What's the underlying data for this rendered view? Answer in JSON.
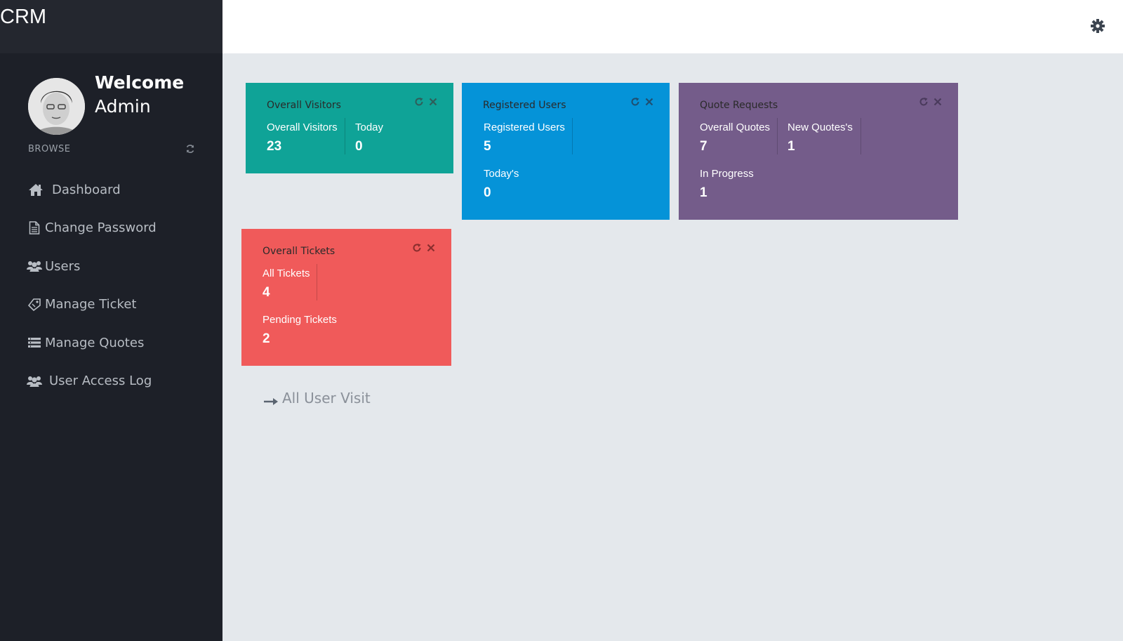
{
  "app": {
    "brand": "CRM"
  },
  "profile": {
    "welcome": "Welcome",
    "name": "Admin"
  },
  "sidebar": {
    "section_label": "BROWSE",
    "items": [
      {
        "label": "Dashboard",
        "icon": "home-icon"
      },
      {
        "label": "Change Password",
        "icon": "file-icon"
      },
      {
        "label": "Users",
        "icon": "users-icon"
      },
      {
        "label": "Manage Ticket",
        "icon": "ticket-icon"
      },
      {
        "label": "Manage Quotes",
        "icon": "list-icon"
      },
      {
        "label": "User Access Log",
        "icon": "users-icon"
      }
    ]
  },
  "widgets": {
    "visitors": {
      "title": "Overall Visitors",
      "color": "#0fa397",
      "stats": [
        {
          "label": "Overall Visitors",
          "value": "23"
        },
        {
          "label": "Today",
          "value": "0"
        }
      ]
    },
    "users": {
      "title": "Registered Users",
      "color": "#0593d8",
      "stats": [
        {
          "label": "Registered Users",
          "value": "5"
        },
        {
          "label": "Today's",
          "value": "0"
        }
      ]
    },
    "quotes": {
      "title": "Quote Requests",
      "color": "#745c8a",
      "stats": [
        {
          "label": "Overall Quotes",
          "value": "7"
        },
        {
          "label": "New Quotes's",
          "value": "1"
        },
        {
          "label": "In Progress",
          "value": "1"
        }
      ]
    },
    "tickets": {
      "title": "Overall Tickets",
      "color": "#f05a5a",
      "stats": [
        {
          "label": "All Tickets",
          "value": "4"
        },
        {
          "label": "Pending Tickets",
          "value": "2"
        }
      ]
    }
  },
  "links": {
    "all_user_visit": "All User Visit"
  }
}
